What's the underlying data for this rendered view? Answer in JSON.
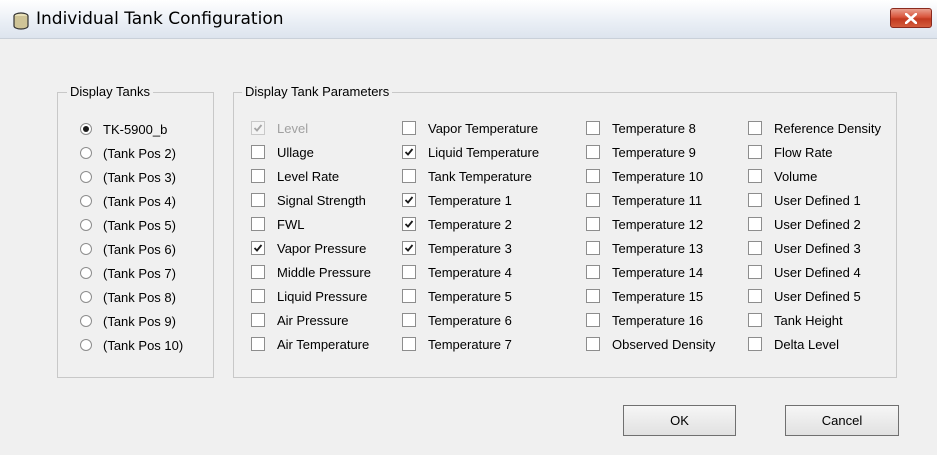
{
  "window": {
    "title": "Individual Tank Configuration",
    "icon": "tank-icon",
    "close_icon": "close-icon",
    "close_color": "#c7402b"
  },
  "display_tanks": {
    "legend": "Display Tanks",
    "selected_index": 0,
    "options": [
      "TK-5900_b",
      "(Tank Pos 2)",
      "(Tank Pos 3)",
      "(Tank Pos 4)",
      "(Tank Pos 5)",
      "(Tank Pos 6)",
      "(Tank Pos 7)",
      "(Tank Pos 8)",
      "(Tank Pos 9)",
      "(Tank Pos 10)"
    ]
  },
  "display_parameters": {
    "legend": "Display Tank Parameters",
    "columns": [
      [
        {
          "label": "Level",
          "checked": true,
          "disabled": true
        },
        {
          "label": "Ullage",
          "checked": false
        },
        {
          "label": "Level Rate",
          "checked": false
        },
        {
          "label": "Signal Strength",
          "checked": false
        },
        {
          "label": "FWL",
          "checked": false
        },
        {
          "label": "Vapor Pressure",
          "checked": true
        },
        {
          "label": "Middle Pressure",
          "checked": false
        },
        {
          "label": "Liquid Pressure",
          "checked": false
        },
        {
          "label": "Air Pressure",
          "checked": false
        },
        {
          "label": "Air Temperature",
          "checked": false
        }
      ],
      [
        {
          "label": "Vapor Temperature",
          "checked": false
        },
        {
          "label": "Liquid Temperature",
          "checked": true
        },
        {
          "label": "Tank Temperature",
          "checked": false
        },
        {
          "label": "Temperature 1",
          "checked": true
        },
        {
          "label": "Temperature 2",
          "checked": true
        },
        {
          "label": "Temperature 3",
          "checked": true
        },
        {
          "label": "Temperature 4",
          "checked": false
        },
        {
          "label": "Temperature 5",
          "checked": false
        },
        {
          "label": "Temperature 6",
          "checked": false
        },
        {
          "label": "Temperature 7",
          "checked": false
        }
      ],
      [
        {
          "label": "Temperature 8",
          "checked": false
        },
        {
          "label": "Temperature 9",
          "checked": false
        },
        {
          "label": "Temperature 10",
          "checked": false
        },
        {
          "label": "Temperature 11",
          "checked": false
        },
        {
          "label": "Temperature 12",
          "checked": false
        },
        {
          "label": "Temperature 13",
          "checked": false
        },
        {
          "label": "Temperature 14",
          "checked": false
        },
        {
          "label": "Temperature 15",
          "checked": false
        },
        {
          "label": "Temperature 16",
          "checked": false
        },
        {
          "label": "Observed Density",
          "checked": false
        }
      ],
      [
        {
          "label": "Reference Density",
          "checked": false
        },
        {
          "label": "Flow Rate",
          "checked": false
        },
        {
          "label": "Volume",
          "checked": false
        },
        {
          "label": "User Defined 1",
          "checked": false
        },
        {
          "label": "User Defined 2",
          "checked": false
        },
        {
          "label": "User Defined 3",
          "checked": false
        },
        {
          "label": "User Defined 4",
          "checked": false
        },
        {
          "label": "User Defined 5",
          "checked": false
        },
        {
          "label": "Tank Height",
          "checked": false
        },
        {
          "label": "Delta Level",
          "checked": false
        }
      ]
    ]
  },
  "buttons": {
    "ok": "OK",
    "cancel": "Cancel"
  }
}
